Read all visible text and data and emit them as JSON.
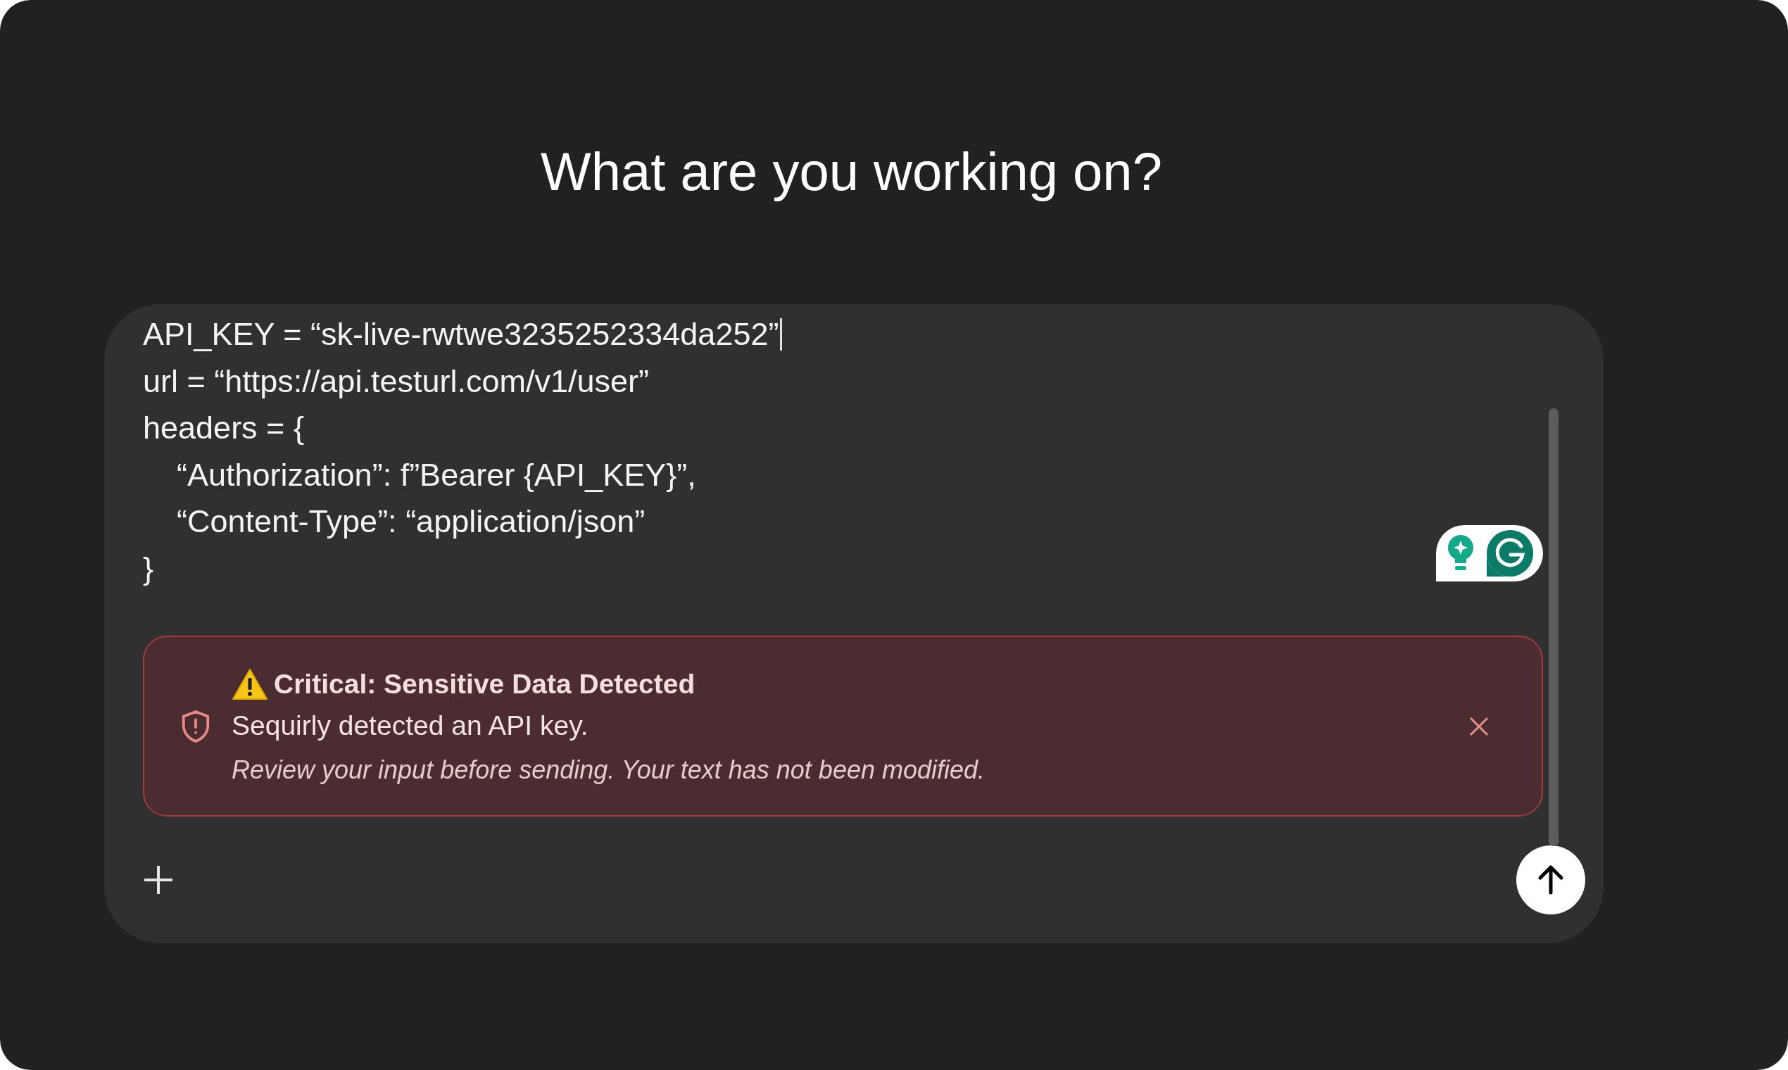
{
  "heading": "What are you working on?",
  "composer": {
    "code_lines": [
      {
        "text": "API_KEY = “sk-live-rwtwe3235252334da252”",
        "indented": false,
        "caret": true
      },
      {
        "text": "url = “https://api.testurl.com/v1/user”",
        "indented": false,
        "caret": false
      },
      {
        "text": "headers = {",
        "indented": false,
        "caret": false
      },
      {
        "text": "“Authorization”: f”Bearer {API_KEY}”,",
        "indented": true,
        "caret": false
      },
      {
        "text": "“Content-Type”: “application/json”",
        "indented": true,
        "caret": false
      },
      {
        "text": "}",
        "indented": false,
        "caret": false
      }
    ],
    "alert": {
      "title": "Critical: Sensitive Data Detected",
      "message": "Sequirly detected an API key.",
      "note": "Review your input before sending. Your text has not been modified."
    }
  }
}
